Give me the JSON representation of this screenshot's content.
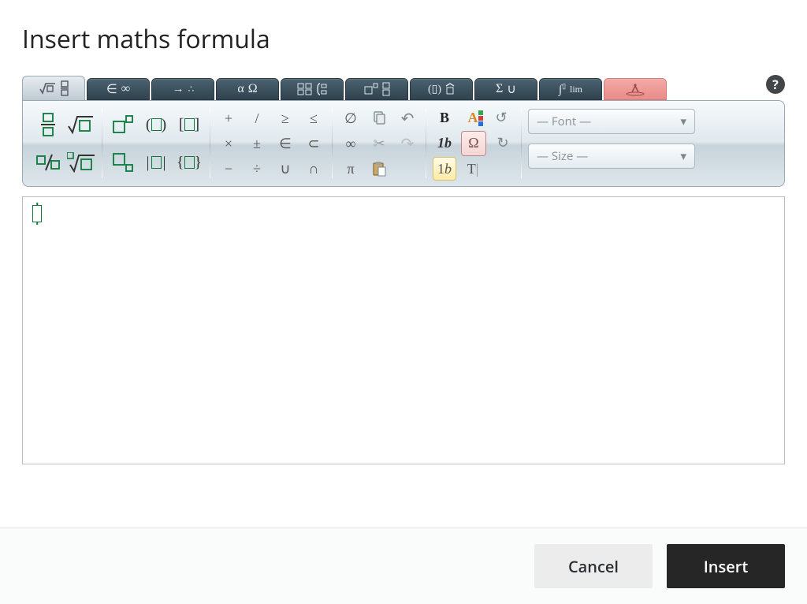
{
  "title": "Insert maths formula",
  "tabs": {
    "active_index": 0,
    "items": [
      {
        "icon": "sqrt-frac-tab",
        "label": ""
      },
      {
        "icon": "elem-infty-tab",
        "label": ""
      },
      {
        "icon": "arrow-dots-tab",
        "label": ""
      },
      {
        "icon": "alpha-omega-tab",
        "label": ""
      },
      {
        "icon": "matrix-tab",
        "label": ""
      },
      {
        "icon": "super-sub-tab",
        "label": ""
      },
      {
        "icon": "accent-tab",
        "label": ""
      },
      {
        "icon": "sigma-union-tab",
        "label": ""
      },
      {
        "icon": "integral-lim-tab",
        "label": ""
      },
      {
        "icon": "hand-tab",
        "label": ""
      }
    ]
  },
  "toolbar": {
    "templates_a": {
      "fraction": "▯⁄▯",
      "sqrt": "√▯",
      "perc_frac": "▯⁄▯",
      "nroot": "ⁿ√▯"
    },
    "templates_b": {
      "superscript": "▯▯",
      "parens": "(▯)",
      "brackets": "[▯]",
      "subscript": "▯▯",
      "abs": "|▯|",
      "braces": "{▯}"
    },
    "ops": {
      "plus": "+",
      "slash": "/",
      "ge": "≥",
      "le": "≤",
      "times": "×",
      "pm": "±",
      "in": "∈",
      "subset": "⊂",
      "minus": "−",
      "div": "÷",
      "cup": "∪",
      "cap": "∩"
    },
    "symbols": {
      "empty": "∅",
      "infty": "∞",
      "pi": "π"
    },
    "edit": {
      "copy": "copy-icon",
      "undo": "↶",
      "cut": "✂",
      "redo": "↷",
      "paste": "paste-icon"
    },
    "format": {
      "bold": "B",
      "fontcolor": "A",
      "rtl": "rtl-icon",
      "italic": "1b",
      "charmap": "Ω",
      "ltr": "ltr-icon",
      "upright": "1b",
      "textmode": "T|"
    },
    "font_placeholder": "— Font —",
    "size_placeholder": "— Size —"
  },
  "editor": {
    "value": ""
  },
  "buttons": {
    "cancel": "Cancel",
    "insert": "Insert"
  },
  "help_label": "?"
}
